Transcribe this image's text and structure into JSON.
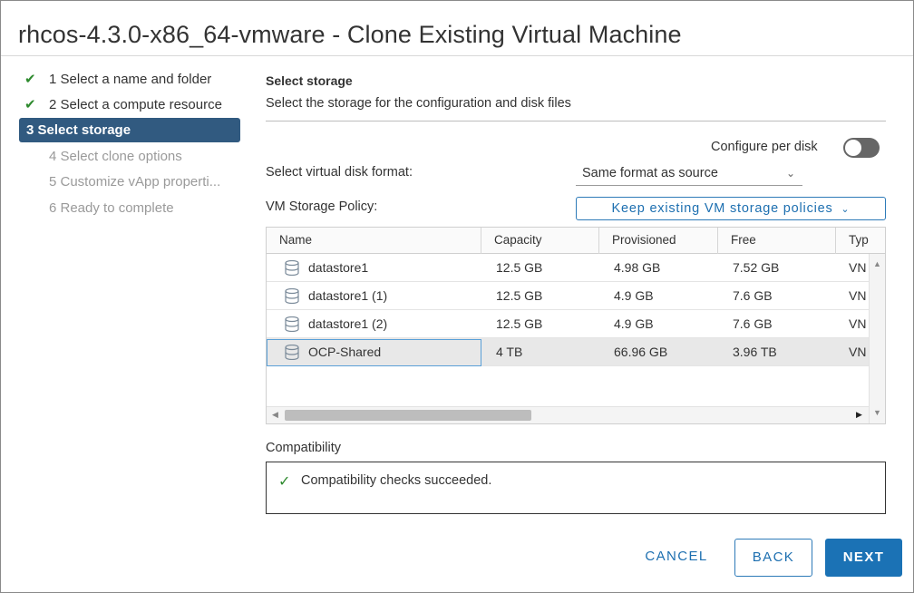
{
  "window": {
    "title": "rhcos-4.3.0-x86_64-vmware - Clone Existing Virtual Machine"
  },
  "steps": [
    {
      "label": "1 Select a name and folder",
      "state": "done"
    },
    {
      "label": "2 Select a compute resource",
      "state": "done"
    },
    {
      "label": "3 Select storage",
      "state": "active"
    },
    {
      "label": "4 Select clone options",
      "state": "disabled"
    },
    {
      "label": "5 Customize vApp properti...",
      "state": "disabled"
    },
    {
      "label": "6 Ready to complete",
      "state": "disabled"
    }
  ],
  "section": {
    "title": "Select storage",
    "subtitle": "Select the storage for the configuration and disk files"
  },
  "configure_per_disk": {
    "label": "Configure per disk",
    "enabled": false
  },
  "disk_format": {
    "label": "Select virtual disk format:",
    "value": "Same format as source"
  },
  "storage_policy": {
    "label": "VM Storage Policy:",
    "value": "Keep existing VM storage policies"
  },
  "grid": {
    "columns": [
      "Name",
      "Capacity",
      "Provisioned",
      "Free",
      "Typ"
    ],
    "rows": [
      {
        "name": "datastore1",
        "capacity": "12.5 GB",
        "provisioned": "4.98 GB",
        "free": "7.52 GB",
        "type": "VN"
      },
      {
        "name": "datastore1 (1)",
        "capacity": "12.5 GB",
        "provisioned": "4.9 GB",
        "free": "7.6 GB",
        "type": "VN"
      },
      {
        "name": "datastore1 (2)",
        "capacity": "12.5 GB",
        "provisioned": "4.9 GB",
        "free": "7.6 GB",
        "type": "VN"
      },
      {
        "name": "OCP-Shared",
        "capacity": "4 TB",
        "provisioned": "66.96 GB",
        "free": "3.96 TB",
        "type": "VN",
        "selected": true
      }
    ]
  },
  "compatibility": {
    "label": "Compatibility",
    "message": "Compatibility checks succeeded."
  },
  "buttons": {
    "cancel": "CANCEL",
    "back": "BACK",
    "next": "NEXT"
  },
  "icons": {
    "check": "check-icon",
    "datastore": "datastore-icon",
    "dropdown": "chevron-down-icon"
  },
  "colors": {
    "accent": "#1b72b5",
    "active_step": "#315a80",
    "success": "#2e8a2e"
  }
}
